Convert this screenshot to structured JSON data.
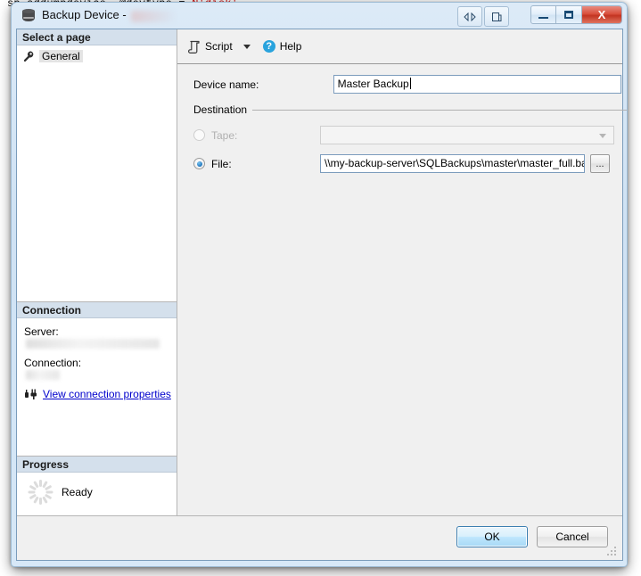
{
  "background": {
    "code_line": "sp_addumpdevice  @devtype = N'disk'",
    "code_keyword": "sp_addumpdevice  @devtype = ",
    "code_string": "N'disk'"
  },
  "window": {
    "title": "Backup Device -",
    "title_redacted": true,
    "icon": "backup-device-icon",
    "nav_buttons": [
      {
        "name": "back-forward-icon",
        "glyph": "◁▷"
      },
      {
        "name": "page-copy-icon",
        "glyph": "▤"
      }
    ],
    "controls": {
      "minimize": "minimize-icon",
      "maximize": "maximize-icon",
      "close_label": "X"
    }
  },
  "sidebar": {
    "select_page_header": "Select a page",
    "pages": [
      {
        "label": "General",
        "icon": "wrench-icon",
        "selected": true
      }
    ],
    "connection": {
      "header": "Connection",
      "server_label": "Server:",
      "server_value": "",
      "connection_label": "Connection:",
      "connection_value": "",
      "view_properties_link": "View connection properties",
      "link_icon": "plug-icon"
    },
    "progress": {
      "header": "Progress",
      "status": "Ready",
      "spinner_icon": "progress-spinner-icon"
    }
  },
  "toolbar": {
    "script_label": "Script",
    "script_icon": "script-icon",
    "dropdown_icon": "chevron-down-icon",
    "help_label": "Help",
    "help_icon": "help-icon"
  },
  "form": {
    "device_name_label": "Device name:",
    "device_name_value": "Master Backup",
    "destination_group": "Destination",
    "tape": {
      "label": "Tape:",
      "selected": false,
      "disabled": true,
      "value": "",
      "dropdown_icon": "chevron-down-icon"
    },
    "file": {
      "label": "File:",
      "selected": true,
      "disabled": false,
      "value": "\\\\my-backup-server\\SQLBackups\\master\\master_full.bak",
      "browse_label": "..."
    }
  },
  "footer": {
    "ok_label": "OK",
    "cancel_label": "Cancel"
  },
  "colors": {
    "titlebar_start": "#dceaf7",
    "titlebar_end": "#d7e8f7",
    "pane_header": "#d4e0ec",
    "dialog_bg": "#f0f0f0",
    "accent_blue": "#2176bd",
    "link_blue": "#0000cc",
    "help_blue": "#29a3dd",
    "close_red": "#c23421",
    "default_btn_border": "#3c7fb1"
  }
}
